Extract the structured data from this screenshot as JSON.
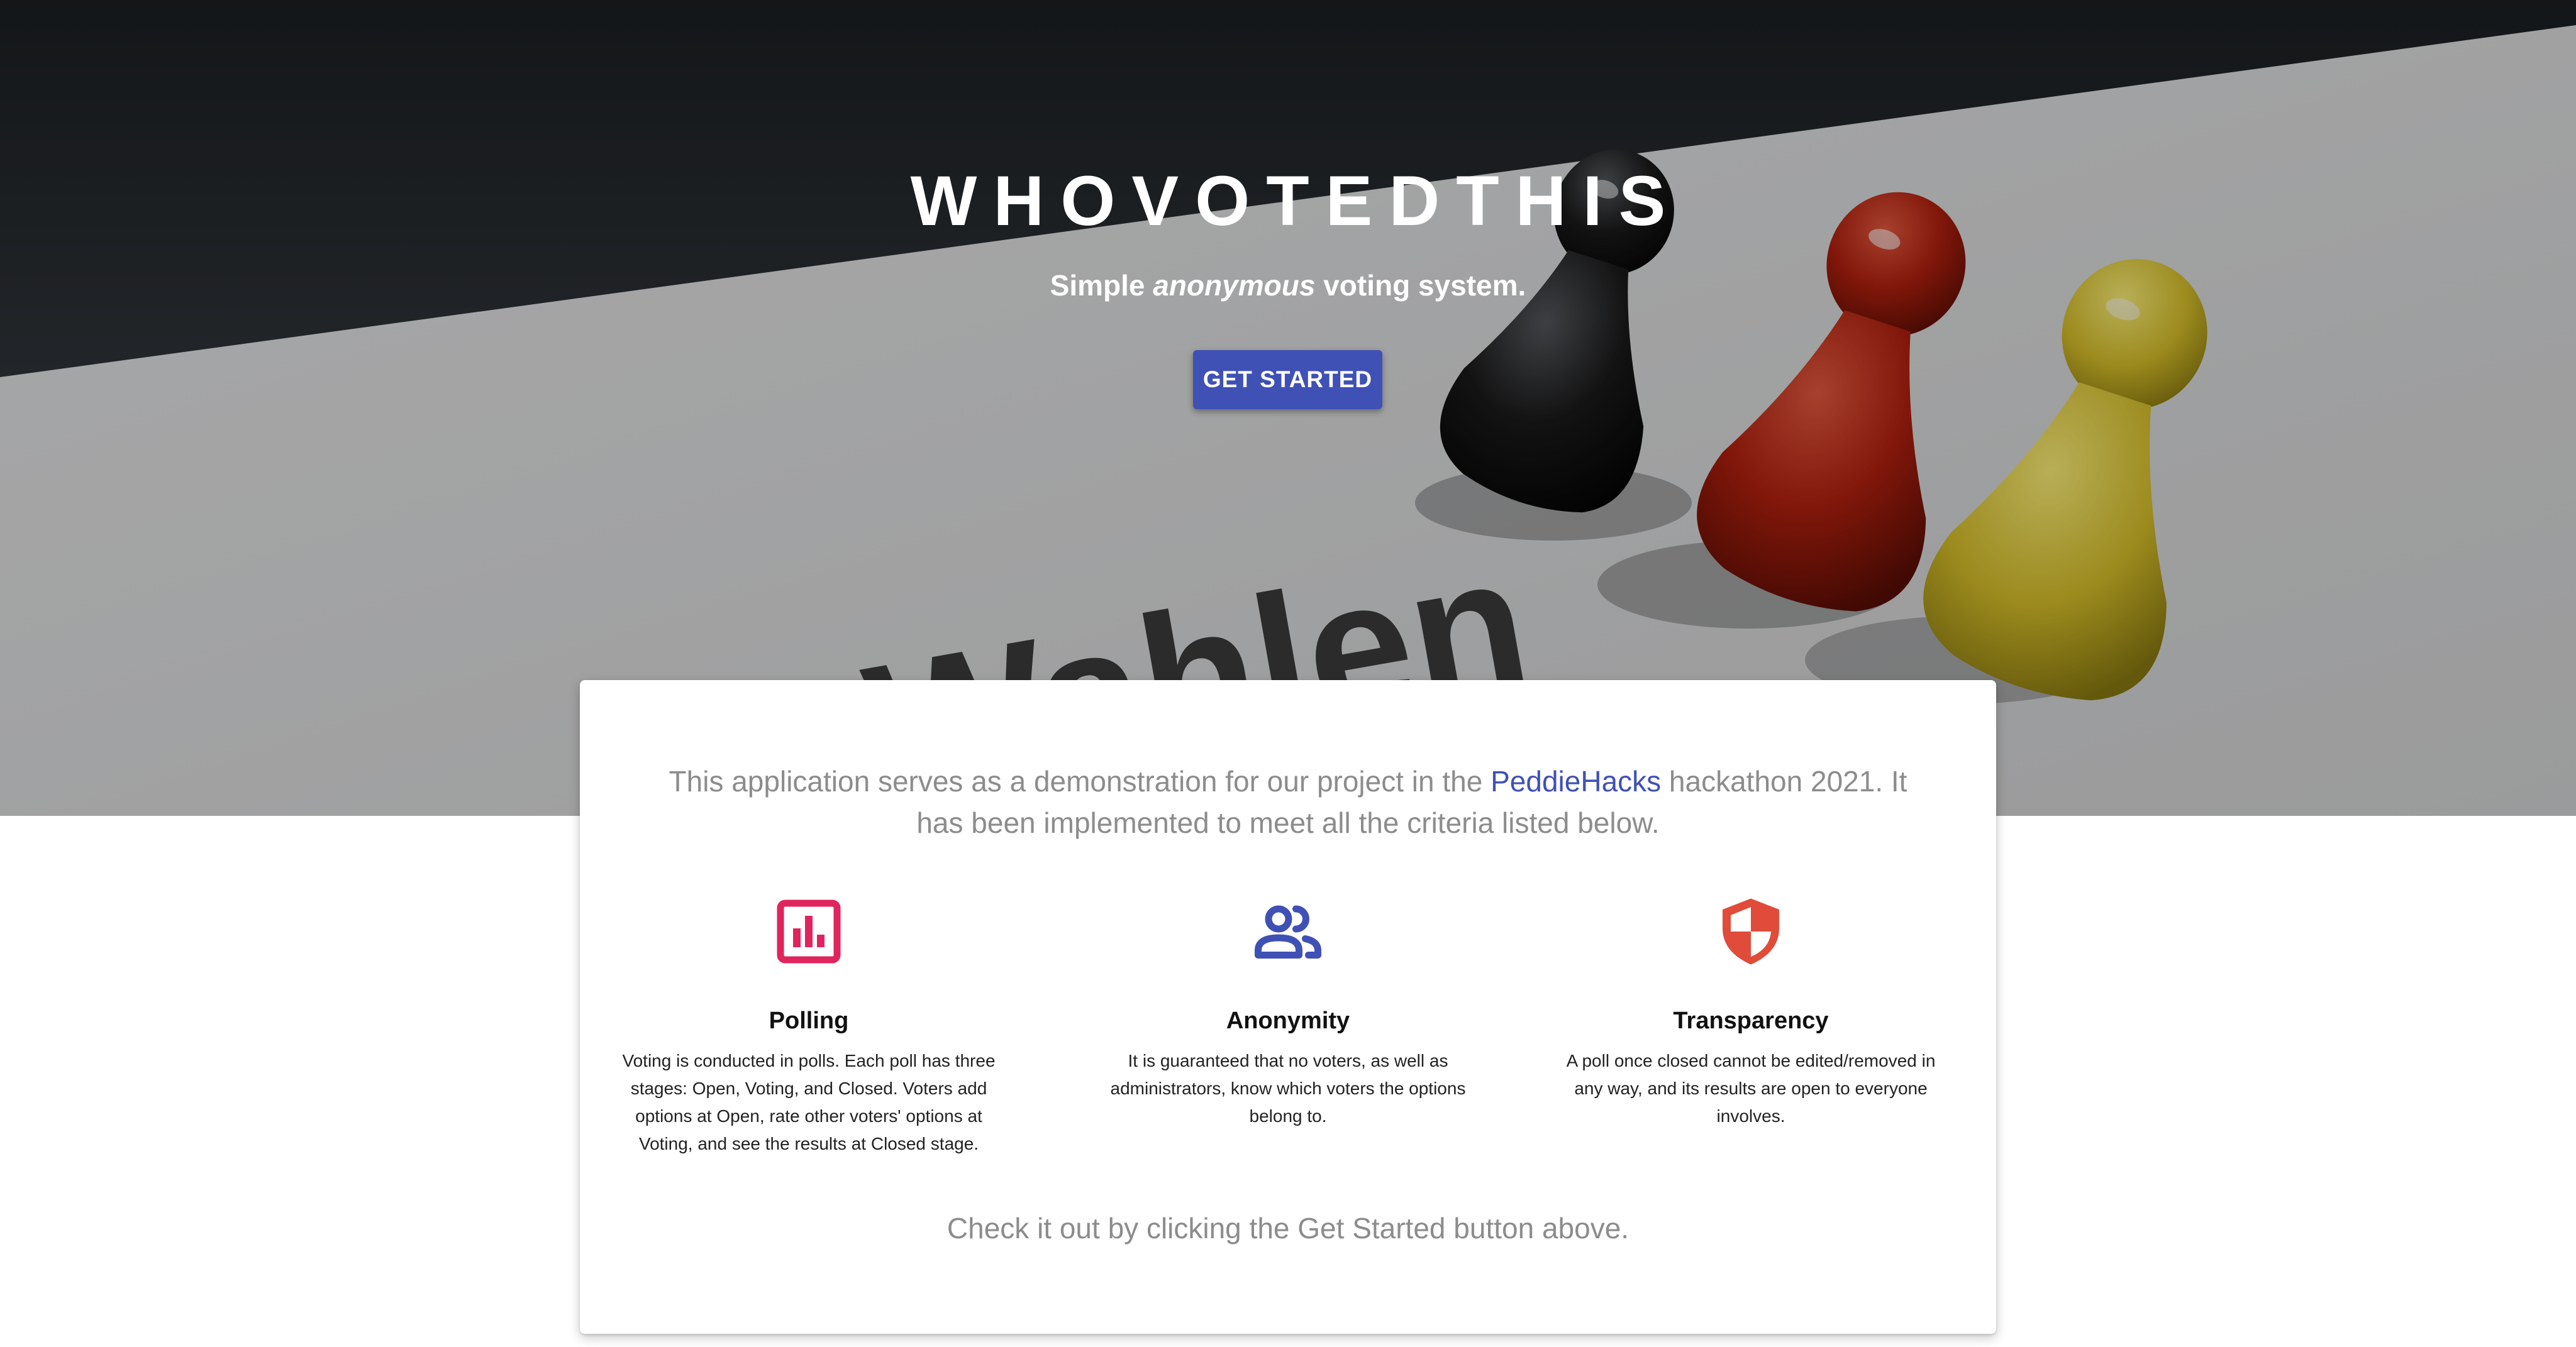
{
  "hero": {
    "title": "WHOVOTEDTHIS",
    "subtitle_before": "Simple ",
    "subtitle_emphasis": "anonymous",
    "subtitle_after": " voting system.",
    "button_label": "GET STARTED",
    "background_text": "Wahlen"
  },
  "card": {
    "intro_before": "This application serves as a demonstration for our project in the ",
    "intro_link": "PeddieHacks",
    "intro_after": " hackathon 2021. It has been implemented to meet all the criteria listed below.",
    "features": [
      {
        "icon": "bar-chart-icon",
        "color": "#e0245e",
        "title": "Polling",
        "description": "Voting is conducted in polls. Each poll has three stages: Open, Voting, and Closed. Voters add options at Open, rate other voters' options at Voting, and see the results at Closed stage."
      },
      {
        "icon": "people-icon",
        "color": "#3f51b5",
        "title": "Anonymity",
        "description": "It is guaranteed that no voters, as well as administrators, know which voters the options belong to."
      },
      {
        "icon": "shield-icon",
        "color": "#e04b3a",
        "title": "Transparency",
        "description": "A poll once closed cannot be edited/removed in any way, and its results are open to everyone involves."
      }
    ],
    "outro": "Check it out by clicking the Get Started button above."
  },
  "colors": {
    "accent": "#3f51b5",
    "muted_text": "#8c8c8c"
  }
}
